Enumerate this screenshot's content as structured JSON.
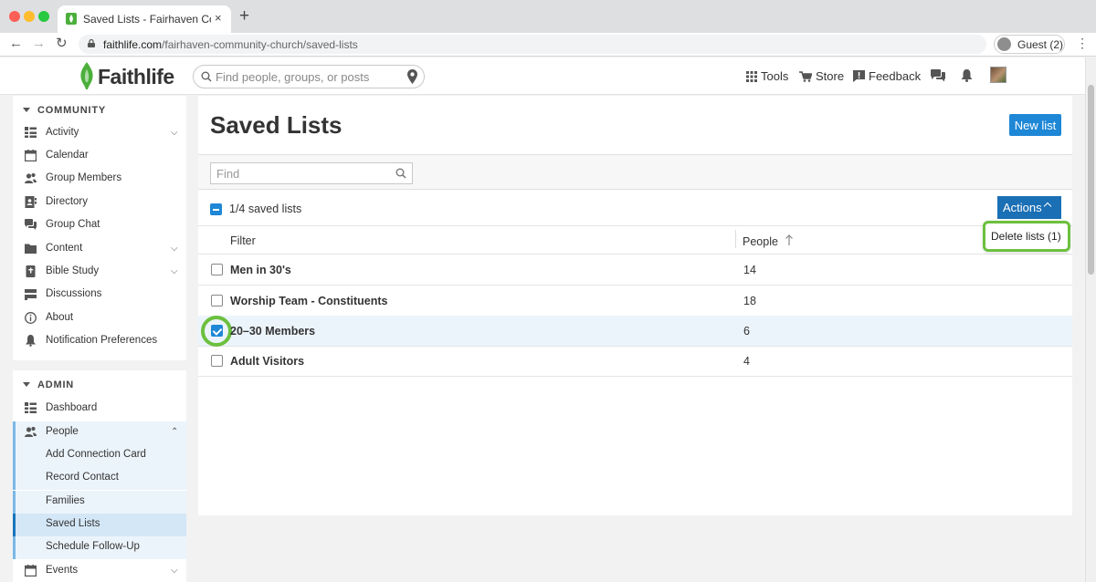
{
  "browser": {
    "tab_title": "Saved Lists - Fairhaven Commu",
    "tab_close": "×",
    "new_tab": "+",
    "url_host": "faithlife.com",
    "url_path": "/fairhaven-community-church/saved-lists",
    "profile_label": "Guest (2)",
    "kebab": "⋮"
  },
  "header": {
    "logo_text": "Faithlife",
    "search_placeholder": "Find people, groups, or posts",
    "tools_label": "Tools",
    "store_label": "Store",
    "feedback_label": "Feedback"
  },
  "sidebar": {
    "community": {
      "heading": "COMMUNITY",
      "items": [
        {
          "label": "Activity",
          "icon": "activity-icon",
          "chevron": "⌄"
        },
        {
          "label": "Calendar",
          "icon": "calendar-icon"
        },
        {
          "label": "Group Members",
          "icon": "people-icon"
        },
        {
          "label": "Directory",
          "icon": "directory-icon"
        },
        {
          "label": "Group Chat",
          "icon": "chat-icon"
        },
        {
          "label": "Content",
          "icon": "folder-icon",
          "chevron": "⌄"
        },
        {
          "label": "Bible Study",
          "icon": "bible-icon",
          "chevron": "⌄"
        },
        {
          "label": "Discussions",
          "icon": "discussions-icon"
        },
        {
          "label": "About",
          "icon": "info-icon"
        },
        {
          "label": "Notification Preferences",
          "icon": "bell-icon"
        }
      ]
    },
    "admin": {
      "heading": "ADMIN",
      "items": [
        {
          "label": "Dashboard",
          "icon": "dashboard-icon"
        },
        {
          "label": "People",
          "icon": "people-icon",
          "chevron": "⌃"
        },
        {
          "label": "Add Connection Card"
        },
        {
          "label": "Record Contact"
        },
        {
          "label": "Families"
        },
        {
          "label": "Saved Lists"
        },
        {
          "label": "Schedule Follow-Up"
        },
        {
          "label": "Events",
          "icon": "calendar-icon",
          "chevron": "⌄"
        }
      ]
    }
  },
  "main": {
    "title": "Saved Lists",
    "new_list_label": "New list",
    "find_placeholder": "Find",
    "selection_count": "1/4 saved lists",
    "actions_label": "Actions",
    "column_filter": "Filter",
    "column_people": "People",
    "dropdown_delete": "Delete lists (1)",
    "rows": [
      {
        "name": "Men in 30's",
        "people": "14",
        "checked": false
      },
      {
        "name": "Worship Team - Constituents",
        "people": "18",
        "checked": false
      },
      {
        "name": "20–30 Members",
        "people": "6",
        "checked": true
      },
      {
        "name": "Adult Visitors",
        "people": "4",
        "checked": false
      }
    ]
  },
  "colors": {
    "accent_blue": "#1e87d6",
    "highlight_green": "#6cc03e",
    "logo_green": "#4caf3c"
  }
}
